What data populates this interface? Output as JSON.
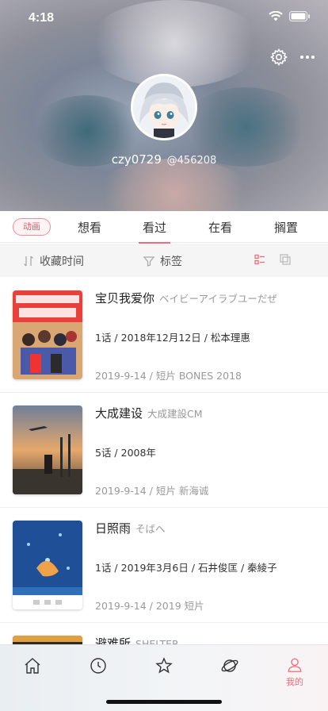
{
  "status_bar": {
    "time": "4:18"
  },
  "profile": {
    "username": "czy0729",
    "uid": "@456208"
  },
  "tabs": {
    "type_chip": "动画",
    "items": [
      {
        "label": "想看"
      },
      {
        "label": "看过",
        "active": true
      },
      {
        "label": "在看"
      },
      {
        "label": "搁置"
      }
    ]
  },
  "filter": {
    "sort_label": "收藏时间",
    "tag_label": "标签"
  },
  "items": [
    {
      "title": "宝贝我爱你",
      "original": "ベイビーアイラブユーだぜ",
      "info": "1话 / 2018年12月12日 / 松本理惠",
      "meta": "2019-9-14 / 短片 BONES 2018"
    },
    {
      "title": "大成建设",
      "original": "大成建設CM",
      "info": "5话 / 2008年",
      "meta": "2019-9-14 / 短片 新海诚"
    },
    {
      "title": "日照雨",
      "original": "そばへ",
      "info": "1话 / 2019年3月6日 / 石井俊匡 / 秦綾子",
      "meta": "2019-9-14 / 2019 短片"
    },
    {
      "title": "避难所",
      "original": "SHELTER"
    }
  ],
  "tabbar": {
    "me_label": "我的"
  },
  "colors": {
    "accent": "#f06b7c",
    "chip_border": "#f28b96"
  }
}
